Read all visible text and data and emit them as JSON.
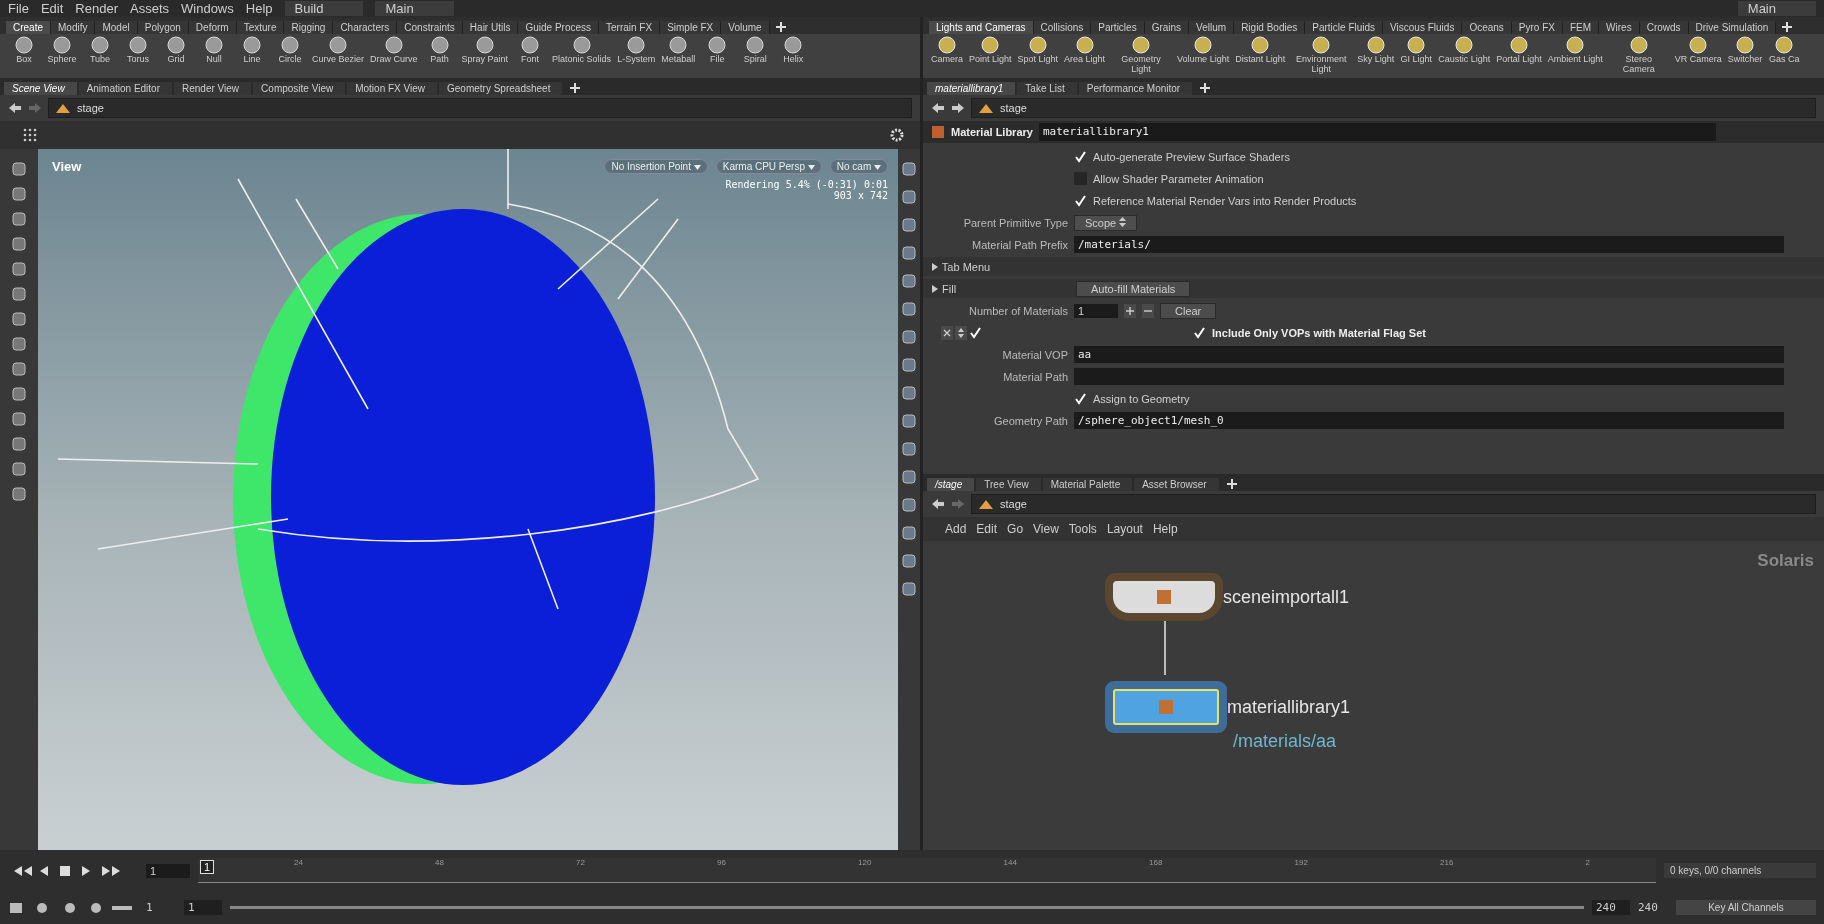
{
  "menu": [
    "File",
    "Edit",
    "Render",
    "Assets",
    "Windows",
    "Help"
  ],
  "desktop": "Build",
  "context": "Main",
  "context_right": "Main",
  "shelf_left": {
    "tabs": [
      {
        "label": "Create",
        "selected": true
      },
      {
        "label": "Modify",
        "selected": false
      },
      {
        "label": "Model",
        "selected": false
      },
      {
        "label": "Polygon",
        "selected": false
      },
      {
        "label": "Deform",
        "selected": false
      },
      {
        "label": "Texture",
        "selected": false
      },
      {
        "label": "Rigging",
        "selected": false
      },
      {
        "label": "Characters",
        "selected": false
      },
      {
        "label": "Constraints",
        "selected": false
      },
      {
        "label": "Hair Utils",
        "selected": false
      },
      {
        "label": "Guide Process",
        "selected": false
      },
      {
        "label": "Terrain FX",
        "selected": false
      },
      {
        "label": "Simple FX",
        "selected": false
      },
      {
        "label": "Volume",
        "selected": false
      }
    ],
    "tools": [
      "Box",
      "Sphere",
      "Tube",
      "Torus",
      "Grid",
      "Null",
      "Line",
      "Circle",
      "Curve Bezier",
      "Draw Curve",
      "Path",
      "Spray Paint",
      "Font",
      "Platonic Solids",
      "L-System",
      "Metaball",
      "File",
      "Spiral",
      "Helix"
    ]
  },
  "shelf_right": {
    "tabs": [
      {
        "label": "Lights and Cameras",
        "selected": true
      },
      {
        "label": "Collisions",
        "selected": false
      },
      {
        "label": "Particles",
        "selected": false
      },
      {
        "label": "Grains",
        "selected": false
      },
      {
        "label": "Vellum",
        "selected": false
      },
      {
        "label": "Rigid Bodies",
        "selected": false
      },
      {
        "label": "Particle Fluids",
        "selected": false
      },
      {
        "label": "Viscous Fluids",
        "selected": false
      },
      {
        "label": "Oceans",
        "selected": false
      },
      {
        "label": "Pyro FX",
        "selected": false
      },
      {
        "label": "FEM",
        "selected": false
      },
      {
        "label": "Wires",
        "selected": false
      },
      {
        "label": "Crowds",
        "selected": false
      },
      {
        "label": "Drive Simulation",
        "selected": false
      }
    ],
    "tools": [
      "Camera",
      "Point Light",
      "Spot Light",
      "Area Light",
      "Geometry Light",
      "Volume Light",
      "Distant Light",
      "Environment Light",
      "Sky Light",
      "GI Light",
      "Caustic Light",
      "Portal Light",
      "Ambient Light",
      "Stereo Camera",
      "VR Camera",
      "Switcher",
      "Gas Ca"
    ]
  },
  "left_pane": {
    "tabs": [
      {
        "label": "Scene View",
        "selected": true
      },
      {
        "label": "Animation Editor",
        "selected": false
      },
      {
        "label": "Render View",
        "selected": false
      },
      {
        "label": "Composite View",
        "selected": false
      },
      {
        "label": "Motion FX View",
        "selected": false
      },
      {
        "label": "Geometry Spreadsheet",
        "selected": false
      }
    ],
    "path": "stage",
    "viewport": {
      "title": "View",
      "dropdowns": [
        "No Insertion Point",
        "Karma CPU  Persp",
        "No cam"
      ],
      "render_status": "Rendering  5.4%  (-0:31)  0:01",
      "resolution": "903 x 742"
    }
  },
  "param_pane": {
    "tabs": [
      {
        "label": "materiallibrary1",
        "selected": true
      },
      {
        "label": "Take List",
        "selected": false
      },
      {
        "label": "Performance Monitor",
        "selected": false
      }
    ],
    "path": "stage",
    "node_type": "Material Library",
    "node_name": "materiallibrary1",
    "params": [
      {
        "kind": "checkbox",
        "label": "Auto-generate Preview Surface Shaders",
        "checked": true
      },
      {
        "kind": "checkbox",
        "label": "Allow Shader Parameter Animation",
        "checked": false
      },
      {
        "kind": "checkbox",
        "label": "Reference Material Render Vars into Render Products",
        "checked": true
      },
      {
        "kind": "menu",
        "label": "Parent Primitive Type",
        "value": "Scope"
      },
      {
        "kind": "field",
        "label": "Material Path Prefix",
        "value": "/materials/"
      },
      {
        "kind": "folder",
        "label": "Tab Menu",
        "expanded": false
      },
      {
        "kind": "folder",
        "label": "Fill",
        "expanded": false,
        "button": "Auto-fill Materials"
      },
      {
        "kind": "count",
        "label": "Number of Materials",
        "value": "1",
        "button": "Clear"
      },
      {
        "kind": "instance",
        "enabled": true,
        "label": "Include Only VOPs with Material Flag Set",
        "checked": true
      },
      {
        "kind": "field",
        "label": "Material VOP",
        "value": "aa"
      },
      {
        "kind": "field",
        "label": "Material Path"
      },
      {
        "kind": "checkbox",
        "label": "Assign to Geometry",
        "checked": true
      },
      {
        "kind": "field",
        "label": "Geometry Path",
        "value": "/sphere_object1/mesh_0"
      }
    ]
  },
  "network_pane": {
    "tabs": [
      {
        "label": "/stage",
        "selected": true
      },
      {
        "label": "Tree View",
        "selected": false
      },
      {
        "label": "Material Palette",
        "selected": false
      },
      {
        "label": "Asset Browser",
        "selected": false
      }
    ],
    "path": "stage",
    "menu": [
      "Add",
      "Edit",
      "Go",
      "View",
      "Tools",
      "Layout",
      "Help"
    ],
    "context_label": "Solaris",
    "nodes": [
      {
        "name": "sceneimportall1",
        "selected": false
      },
      {
        "name": "materiallibrary1",
        "selected": true,
        "note": "/materials/aa"
      }
    ]
  },
  "timeline": {
    "current_frame": "1",
    "marker": "1",
    "ticks": [
      "24",
      "48",
      "72",
      "96",
      "120",
      "144",
      "168",
      "192",
      "216",
      "2"
    ],
    "start": "1",
    "level": 1,
    "range_start": "1",
    "range_end": "240",
    "end": "240",
    "keys": "0 keys, 0/0 channels",
    "key_button": "Key All Channels"
  }
}
